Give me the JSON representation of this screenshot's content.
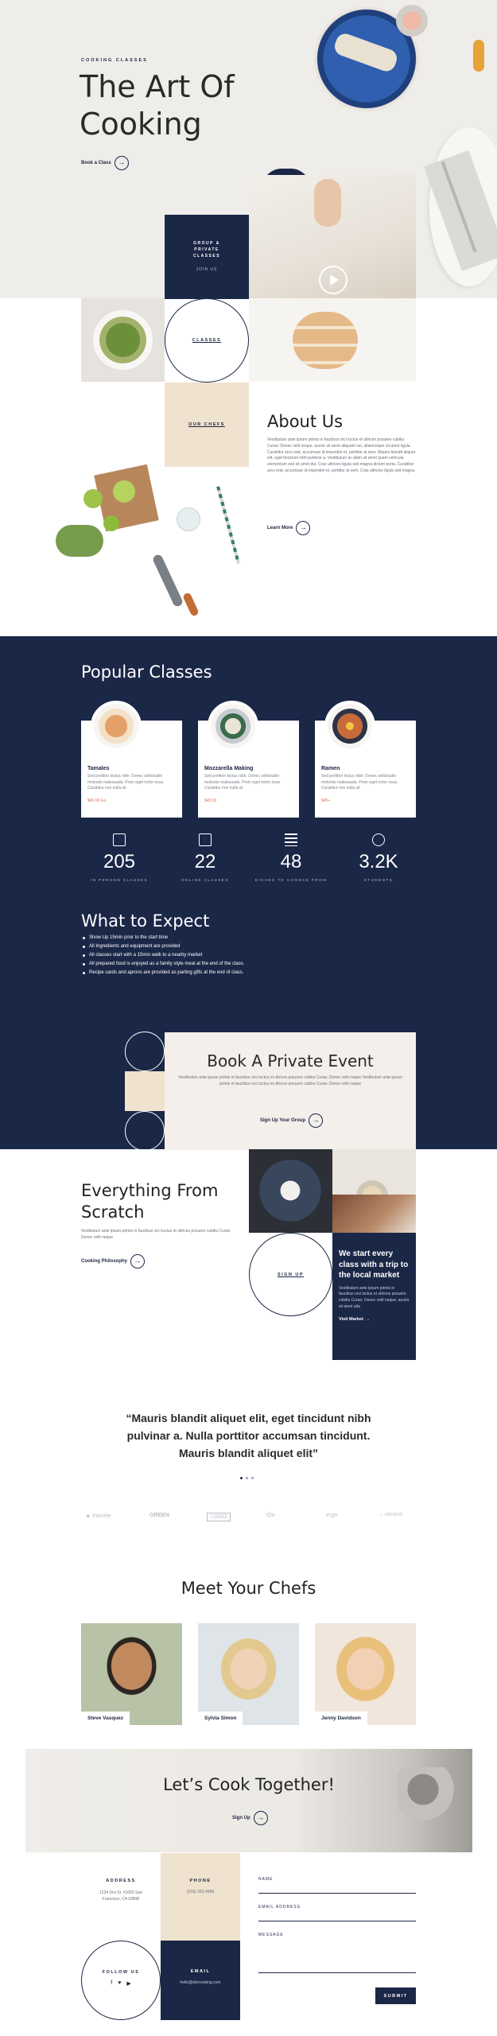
{
  "hero": {
    "eyebrow": "COOKING CLASSES",
    "title_line1": "The Art Of",
    "title_line2": "Cooking",
    "cta": "Book a Class"
  },
  "grid": {
    "group_title": "GROUP & PRIVATE CLASSES",
    "group_link": "JOIN US",
    "classes_label": "CLASSES",
    "chefs_label": "OUR CHEFS"
  },
  "about": {
    "title": "About Us",
    "body": "Vestibulum ante ipsum primis in faucibus orci luctus et ultrices posuere cubilia Curae; Donec velit neque, auctor sit amet aliquam vel, ullamcorper sit amet ligula. Curabitur arcu erat, accumsan id imperdiet et, porttitor at sem. Mauris blandit aliquet elit, eget tincidunt nibh pulvinar a. Vestibulum ac diam sit amet quam vehicula elementum sed sit amet dui. Cras ultricies ligula sed magna dictum porta. Curabitur arcu erat, accumsan id imperdiet et, porttitor at sem. Cras ultricies ligula sed magna.",
    "cta": "Learn More"
  },
  "popular": {
    "title": "Popular Classes",
    "cards": [
      {
        "name": "Tamales",
        "desc": "Sed porttitor lectus nibh. Donec sollicitudin molestie malesuada. Proin eget tortor risus. Curabitur non nulla sit",
        "price": "$45.00 Ea."
      },
      {
        "name": "Mozzarella Making",
        "desc": "Sed porttitor lectus nibh. Donec sollicitudin molestie malesuada. Proin eget tortor risus. Curabitur non nulla sit",
        "price": "$45.00"
      },
      {
        "name": "Ramen",
        "desc": "Sed porttitor lectus nibh. Donec sollicitudin molestie malesuada. Proin eget tortor risus. Curabitur non nulla sit",
        "price": "$45+"
      }
    ]
  },
  "stats": [
    {
      "value": "205",
      "label": "IN PERSON CLASSES"
    },
    {
      "value": "22",
      "label": "ONLINE CLASSES"
    },
    {
      "value": "48",
      "label": "DISHES TO CHOOSE FROM"
    },
    {
      "value": "3.2K",
      "label": "STUDENTS"
    }
  ],
  "expect": {
    "title": "What to Expect",
    "items": [
      "Show Up 15min prior to the start time",
      "All Ingredients and equipment are provided",
      "All classes start with a 15min walk to a nearby market",
      "All prepared food is enjoyed as a family style meal at the end of the class.",
      "Recipe cards and aprons are provided as parting gifts at the end of class."
    ]
  },
  "private": {
    "title": "Book A Private Event",
    "body": "Vestibulum ante ipsum primis in faucibus orci luctus et ultrices posuere cubilia Curae; Donec velit neque Vestibulum ante ipsum primis in faucibus orci luctus et ultrices posuere cubilia Curae; Donec velit neque",
    "cta": "Sign Up Your Group"
  },
  "scratch": {
    "title_line1": "Everything From",
    "title_line2": "Scratch",
    "body": "Vestibulum ante ipsum primis in faucibus orci luctus et ultrices posuere cubilia Curae; Donec velit neque",
    "cta": "Cooking Philosophy",
    "signup": "SIGN UP",
    "market_title": "We start every class with a trip to the local market",
    "market_body": "Vestibulum ante ipsum primis in faucibus orci luctus et ultrices posuere cubilia Curae; Donec velit neque, auctor sit amet aliq",
    "market_cta": "Visit Market"
  },
  "quote": {
    "text": "“Mauris blandit aliquet elit, eget tincidunt nibh pulvinar a. Nulla porttitor accumsan tincidunt. Mauris blandit aliquet elit”"
  },
  "logos": [
    "ForsHe",
    "GREEN",
    "LOGO",
    "lOe",
    "ergo",
    "FASHION"
  ],
  "chefs": {
    "title": "Meet Your Chefs",
    "list": [
      {
        "name": "Steve Vasquez"
      },
      {
        "name": "Sylvia Simon"
      },
      {
        "name": "Jenny Davidson"
      }
    ]
  },
  "cta_banner": {
    "title": "Let’s Cook Together!",
    "cta": "Sign Up"
  },
  "contact": {
    "address_label": "ADDRESS",
    "address": "1234 Divi St. #1000 San Francisco, CA 93848",
    "phone_label": "PHONE",
    "phone": "(916) 333-4968",
    "follow_label": "FOLLOW US",
    "email_label": "EMAIL",
    "email": "hello@divicooking.com",
    "form": {
      "name_label": "NAME",
      "email_label": "EMAIL ADDRESS",
      "message_label": "MESSAGE",
      "submit": "SUBMIT"
    }
  },
  "colors": {
    "navy": "#1b2747",
    "beige": "#efe2cf",
    "hero_bg": "#efede9",
    "price": "#d9765a"
  }
}
